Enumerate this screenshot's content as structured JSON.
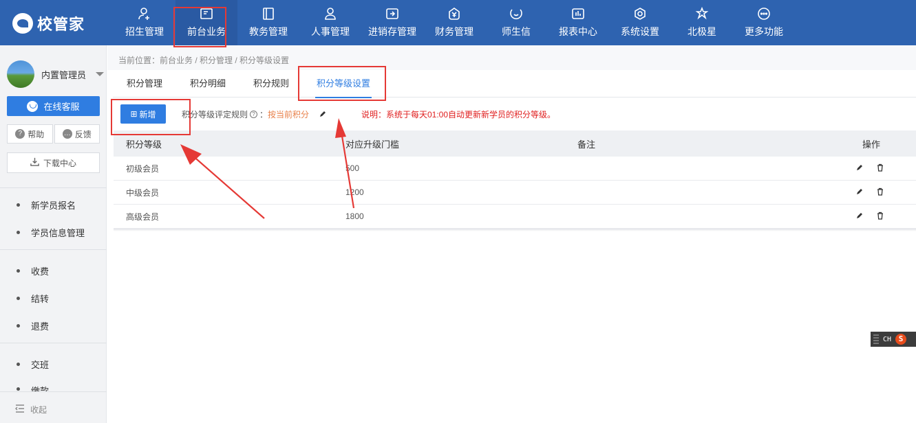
{
  "app": {
    "logo_text": "校管家"
  },
  "nav": {
    "items": [
      {
        "label": "招生管理",
        "icon": "user-plus-icon"
      },
      {
        "label": "前台业务",
        "icon": "desk-icon"
      },
      {
        "label": "教务管理",
        "icon": "book-icon"
      },
      {
        "label": "人事管理",
        "icon": "person-icon"
      },
      {
        "label": "进销存管理",
        "icon": "inventory-icon"
      },
      {
        "label": "财务管理",
        "icon": "finance-icon"
      },
      {
        "label": "师生信",
        "icon": "chat-icon"
      },
      {
        "label": "报表中心",
        "icon": "report-icon"
      },
      {
        "label": "系统设置",
        "icon": "settings-icon"
      },
      {
        "label": "北极星",
        "icon": "star-icon"
      },
      {
        "label": "更多功能",
        "icon": "more-icon"
      }
    ],
    "active_index": 1
  },
  "sidebar": {
    "user_name": "内置管理员",
    "service_label": "在线客服",
    "help_label": "帮助",
    "feedback_label": "反馈",
    "download_label": "下载中心",
    "groups": [
      [
        "新学员报名",
        "学员信息管理"
      ],
      [
        "收费",
        "结转",
        "退费"
      ],
      [
        "交班",
        "缴款"
      ]
    ],
    "collapse_label": "收起"
  },
  "breadcrumb": "当前位置：前台业务 / 积分管理 / 积分等级设置",
  "tabs": [
    "积分管理",
    "积分明细",
    "积分规则",
    "积分等级设置"
  ],
  "active_tab": 3,
  "toolbar": {
    "add_label": "新增",
    "rule_label": "积分等级评定规则",
    "rule_value": "按当前积分",
    "note": "说明：系统于每天01:00自动更新新学员的积分等级。"
  },
  "table": {
    "headers": [
      "积分等级",
      "对应升级门槛",
      "备注",
      "操作"
    ],
    "rows": [
      {
        "level": "初级会员",
        "threshold": "500",
        "remark": ""
      },
      {
        "level": "中级会员",
        "threshold": "1200",
        "remark": ""
      },
      {
        "level": "高级会员",
        "threshold": "1800",
        "remark": ""
      }
    ]
  },
  "ime": {
    "label": "CH",
    "logo": "S"
  },
  "colors": {
    "nav_bg": "#2e63b0",
    "primary": "#2f7de1",
    "rule_value": "#e8804a",
    "note": "#e02020",
    "annotation": "#e53935"
  }
}
